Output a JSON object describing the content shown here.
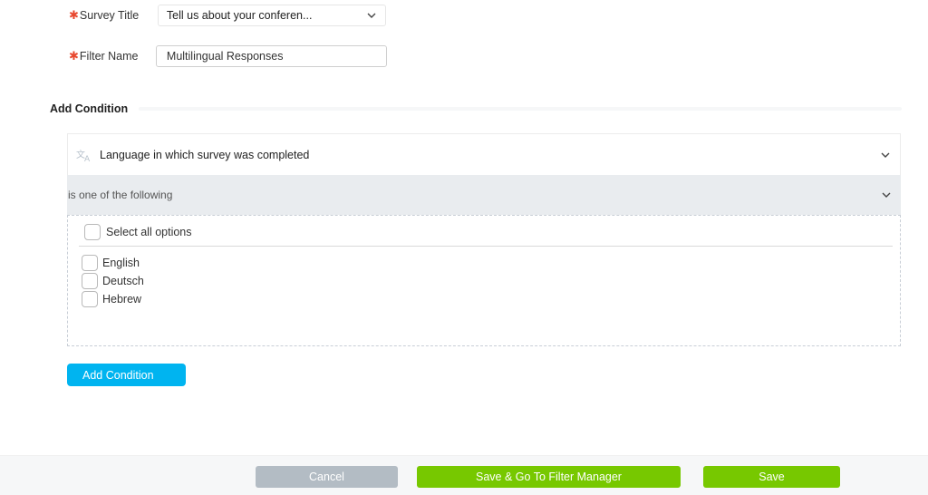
{
  "form": {
    "survey_title": {
      "label": "Survey Title",
      "required_mark": "✱",
      "selected": "Tell us about your conferen..."
    },
    "filter_name": {
      "label": "Filter Name",
      "required_mark": "✱",
      "value": "Multilingual Responses"
    }
  },
  "conditions": {
    "heading": "Add Condition",
    "items": [
      {
        "field_icon": "translate-icon",
        "field": "Language in which survey was completed",
        "operator": "is one of the following",
        "select_all_label": "Select all options",
        "options": [
          {
            "label": "English",
            "checked": false
          },
          {
            "label": "Deutsch",
            "checked": false
          },
          {
            "label": "Hebrew",
            "checked": false
          }
        ]
      }
    ],
    "add_button": "Add Condition"
  },
  "footer": {
    "cancel": "Cancel",
    "save_and_go": "Save & Go To Filter Manager",
    "save": "Save"
  },
  "colors": {
    "accent_blue": "#00b4f0",
    "save_green": "#77c800",
    "cancel_gray": "#b3bcc4",
    "required_red": "#e8482f"
  }
}
